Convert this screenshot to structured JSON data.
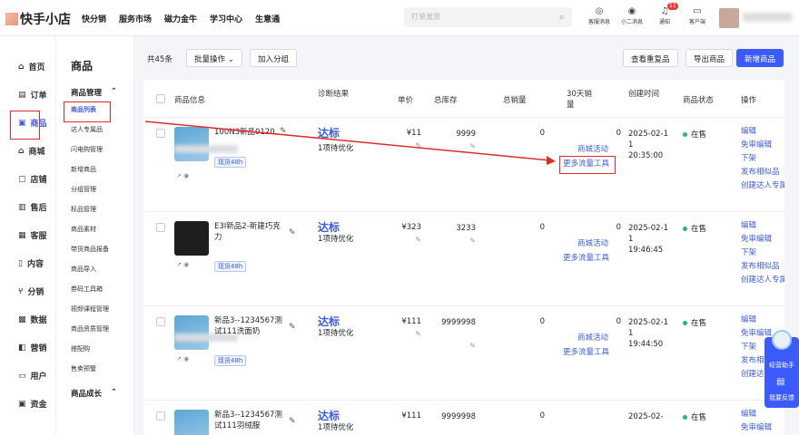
{
  "header": {
    "logo": "快手小店",
    "nav": [
      "快分销",
      "服务市场",
      "磁力金牛",
      "学习中心",
      "生意通"
    ],
    "search_placeholder": "打单发货",
    "tools": [
      {
        "icon": "robot-icon",
        "label": "客服消息"
      },
      {
        "icon": "chat-icon",
        "label": "小二消息"
      },
      {
        "icon": "bell-icon",
        "label": "通知",
        "badge": "11"
      },
      {
        "icon": "monitor-icon",
        "label": "客户端"
      }
    ]
  },
  "sidebar": [
    {
      "icon": "home-icon",
      "label": "首页"
    },
    {
      "icon": "order-icon",
      "label": "订单"
    },
    {
      "icon": "goods-icon",
      "label": "商品",
      "active": true
    },
    {
      "icon": "mall-icon",
      "label": "商城"
    },
    {
      "icon": "shop-icon",
      "label": "店铺"
    },
    {
      "icon": "aftersale-icon",
      "label": "售后"
    },
    {
      "icon": "service-icon",
      "label": "客服"
    },
    {
      "icon": "content-icon",
      "label": "内容"
    },
    {
      "icon": "distribution-icon",
      "label": "分销"
    },
    {
      "icon": "data-icon",
      "label": "数据"
    },
    {
      "icon": "marketing-icon",
      "label": "营销"
    },
    {
      "icon": "user-icon",
      "label": "用户"
    },
    {
      "icon": "fund-icon",
      "label": "资金"
    }
  ],
  "subnav": {
    "title": "商品",
    "group1": "商品管理",
    "items": [
      "商品列表",
      "达人专属品",
      "闪电购管理",
      "新增商品",
      "分组管理",
      "标品管理",
      "商品素材",
      "带货商品报备",
      "商品导入",
      "券码工具箱",
      "视频课程管理",
      "商品资质管理",
      "搭配购",
      "售卖预警"
    ],
    "group2": "商品成长"
  },
  "toolbar": {
    "total": "共45条",
    "batch": "批量操作",
    "add_group": "加入分组",
    "check_dup": "查看重复品",
    "export": "导出商品",
    "add_new": "新增商品"
  },
  "table": {
    "headers": {
      "info": "商品信息",
      "diag": "诊断结果",
      "price": "单价",
      "stock": "总库存",
      "sold": "总销量",
      "sold30": "30天销量",
      "ctime": "创建时间",
      "status": "商品状态",
      "ops": "操作"
    },
    "rows": [
      {
        "name": "100N3新品0120",
        "tag": "现货48h",
        "diag": "达标",
        "diag_sub": "1项待优化",
        "price": "¥11",
        "stock": "9999",
        "sold": "0",
        "sold30": "0",
        "date": "2025-02-11",
        "time": "20:35:00",
        "status": "在售",
        "links": [
          "商城活动",
          "更多流量工具"
        ]
      },
      {
        "name": "E3I新品2-新建巧克力",
        "tag": "现货48h",
        "diag": "达标",
        "diag_sub": "1项待优化",
        "price": "¥323",
        "stock": "3233",
        "sold": "0",
        "sold30": "0",
        "date": "2025-02-11",
        "time": "19:46:45",
        "status": "在售",
        "links": [
          "商城活动",
          "更多流量工具"
        ]
      },
      {
        "name": "新品3--1234567测试111洗面奶",
        "tag": "现货48h",
        "diag": "达标",
        "diag_sub": "1项待优化",
        "price": "¥111",
        "stock": "9999998",
        "sold": "0",
        "sold30": "0",
        "date": "2025-02-11",
        "time": "19:44:50",
        "status": "在售",
        "links": [
          "商城活动",
          "更多流量工具"
        ]
      },
      {
        "name": "新品3--1234567测试111羽绒服",
        "tag": "",
        "diag": "达标",
        "diag_sub": "1项待优化",
        "price": "¥111",
        "stock": "9999998",
        "sold": "0",
        "sold30": "",
        "date": "2025-02-",
        "time": "",
        "status": "在售",
        "links": []
      }
    ],
    "ops": [
      "编辑",
      "免审编辑",
      "下架",
      "发布相似品",
      "创建达人专属"
    ]
  },
  "helper": {
    "top": "经营助手",
    "bottom": "我要反馈"
  }
}
